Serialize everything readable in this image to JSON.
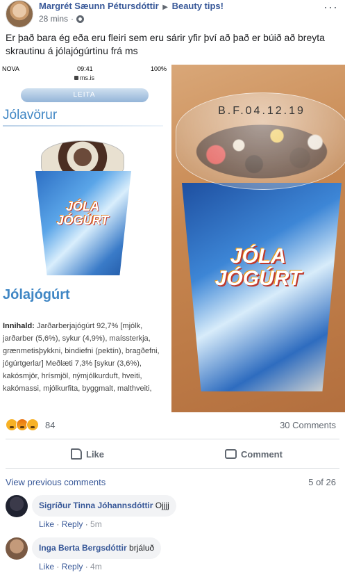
{
  "post": {
    "author": "Margrét Sæunn Pétursdóttir",
    "group": "Beauty tips!",
    "time": "28 mins",
    "text": "Er það bara ég eða eru fleiri sem eru sárir yfir því að það er búið að breyta skrautinu á jólajógúrtinu frá ms",
    "more": "···"
  },
  "photo_left": {
    "status_carrier": "NOVA",
    "status_time": "09:41",
    "status_battery": "100%",
    "url": "ms.is",
    "search_button": "LEITA",
    "category": "Jólavörur",
    "cup_label": "JÓLA JÓGÚRT",
    "product_name": "Jólajógúrt",
    "ingredients": {
      "label": "Innihald:",
      "text": "Jarðarberjajógúrt 92,7% [mjólk, jarðarber (5,6%), sykur (4,9%), maíssterkja, grænmetisþykkni, bindiefni (pektín), bragðefni, jógúrtgerlar] Meðlæti 7,3% [sykur (3,6%), kakósmjör, hrísmjöl, nýmjólkurduft, hveiti, kakómassi, mjólkurfita, byggmalt, malthveiti,"
    }
  },
  "photo_right": {
    "lid_print": "B.F.04.12.19",
    "cup_label": "JÓLA JÓGÚRT"
  },
  "reactions": {
    "count": "84",
    "comments": "30 Comments"
  },
  "actions": {
    "like": "Like",
    "comment": "Comment"
  },
  "comments_section": {
    "view_previous": "View previous comments",
    "pager": "5 of 26",
    "items": [
      {
        "name": "Sigríður Tinna Jóhannsdóttir",
        "text": "Ojjjj",
        "like": "Like",
        "reply": "Reply",
        "time": "5m"
      },
      {
        "name": "Inga Berta Bergsdóttir",
        "text": "brjáluð",
        "like": "Like",
        "reply": "Reply",
        "time": "4m"
      }
    ]
  }
}
